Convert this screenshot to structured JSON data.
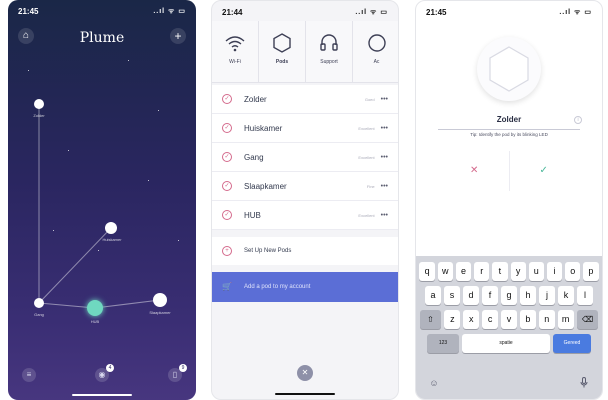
{
  "screen1": {
    "status": {
      "time": "21:45",
      "signal": "..ıl ᯤ ▭"
    },
    "title": "Plume",
    "home_icon": "⌂",
    "add_icon": "+",
    "nodes": [
      {
        "label": "Zolder"
      },
      {
        "label": "Huiskamer"
      },
      {
        "label": "Gang"
      },
      {
        "label": "HUB"
      },
      {
        "label": "Slaapkamer"
      }
    ],
    "bottom": {
      "menu_icon": "≡",
      "devices_badge": "4",
      "phones_badge": "9"
    }
  },
  "screen2": {
    "status": {
      "time": "21:44",
      "signal": "..ıl ᯤ ▭"
    },
    "tabs": [
      {
        "label": "Wi-Fi",
        "icon": "wifi-icon"
      },
      {
        "label": "Pods",
        "icon": "hexagon-icon"
      },
      {
        "label": "Support",
        "icon": "headset-icon"
      },
      {
        "label": "Ac",
        "icon": "account-icon"
      }
    ],
    "pods": [
      {
        "name": "Zolder",
        "status": "Goed"
      },
      {
        "name": "Huiskamer",
        "status": "Excellent"
      },
      {
        "name": "Gang",
        "status": "Excellent"
      },
      {
        "name": "Slaapkamer",
        "status": "Fine"
      },
      {
        "name": "HUB",
        "status": "Excellent"
      }
    ],
    "more": "•••",
    "check": "✓",
    "setup_label": "Set Up New Pods",
    "addpod_label": "Add a pod to my account",
    "close": "✕"
  },
  "screen3": {
    "status": {
      "time": "21:45",
      "signal": "..ıl ᯤ ▭"
    },
    "name_value": "Zolder",
    "tip": "Tip: Identify the pod by its blinking LED",
    "cancel": "✕",
    "confirm": "✓",
    "keyboard": {
      "row1": [
        "q",
        "w",
        "e",
        "r",
        "t",
        "y",
        "u",
        "i",
        "o",
        "p"
      ],
      "row2": [
        "a",
        "s",
        "d",
        "f",
        "g",
        "h",
        "j",
        "k",
        "l"
      ],
      "row3": [
        "z",
        "x",
        "c",
        "v",
        "b",
        "n",
        "m"
      ],
      "shift": "⇧",
      "backspace": "⌫",
      "numbers": "123",
      "space": "spatie",
      "go": "Gereed",
      "emoji": "☺",
      "mic": "🎤"
    }
  },
  "colors": {
    "accent": "#5b6ed6",
    "pink": "#d46a8c",
    "green": "#4bb89a",
    "night": "#2a2660"
  }
}
